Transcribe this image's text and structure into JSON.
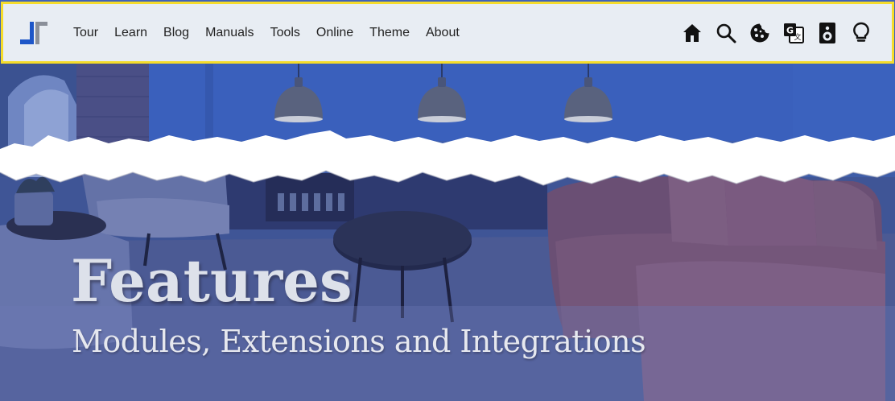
{
  "nav": {
    "links": [
      "Tour",
      "Learn",
      "Blog",
      "Manuals",
      "Tools",
      "Online",
      "Theme",
      "About"
    ],
    "icons": [
      "home-icon",
      "search-icon",
      "cookie-icon",
      "translate-icon",
      "speaker-icon",
      "lightbulb-icon"
    ],
    "highlight_color": "#f5dc2a"
  },
  "hero": {
    "title": "Features",
    "subtitle": "Modules, Extensions and Integrations"
  }
}
